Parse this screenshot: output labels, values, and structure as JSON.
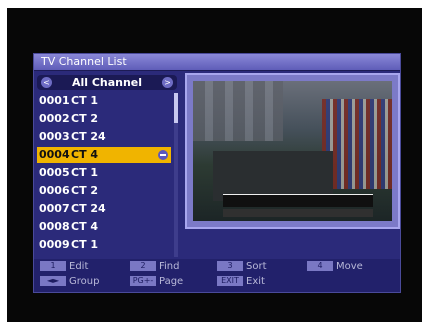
{
  "window": {
    "title": "TV Channel List"
  },
  "group": {
    "label": "All Channel",
    "left_arrow": "<",
    "right_arrow": ">"
  },
  "channels": [
    {
      "number": "0001",
      "name": "CT 1",
      "selected": false
    },
    {
      "number": "0002",
      "name": "CT 2",
      "selected": false
    },
    {
      "number": "0003",
      "name": "CT 24",
      "selected": false
    },
    {
      "number": "0004",
      "name": "CT 4",
      "selected": true
    },
    {
      "number": "0005",
      "name": "CT 1",
      "selected": false
    },
    {
      "number": "0006",
      "name": "CT 2",
      "selected": false
    },
    {
      "number": "0007",
      "name": "CT 24",
      "selected": false
    },
    {
      "number": "0008",
      "name": "CT 4",
      "selected": false
    },
    {
      "number": "0009",
      "name": "CT 1",
      "selected": false
    }
  ],
  "footer": {
    "edit": {
      "key": "1",
      "label": "Edit"
    },
    "find": {
      "key": "2",
      "label": "Find"
    },
    "sort": {
      "key": "3",
      "label": "Sort"
    },
    "move": {
      "key": "4",
      "label": "Move"
    },
    "group": {
      "key": "◄►",
      "label": "Group"
    },
    "page": {
      "key": "PG+-",
      "label": "Page"
    },
    "exit": {
      "key": "EXIT",
      "label": "Exit"
    }
  },
  "colors": {
    "panel": "#2b2a7a",
    "selection": "#f0b400",
    "title_bar": "#7472c8"
  }
}
